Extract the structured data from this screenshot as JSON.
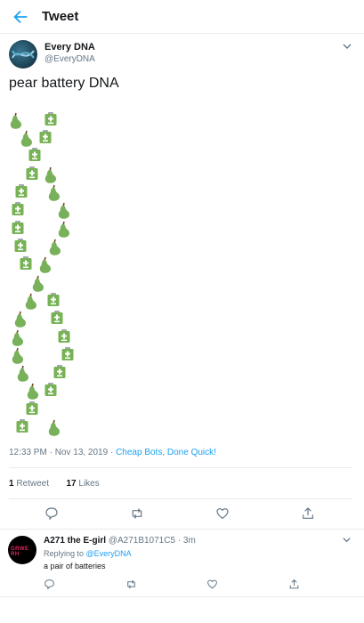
{
  "header": {
    "title": "Tweet"
  },
  "tweet": {
    "author_name": "Every DNA",
    "author_handle": "@EveryDNA",
    "text": "pear battery DNA",
    "art_icons": [
      "pear-emoji",
      "battery-emoji"
    ],
    "timestamp": "12:33 PM · Nov 13, 2019 · ",
    "source": "Cheap Bots, Done Quick!",
    "retweets_count": "1",
    "retweets_label": " Retweet",
    "likes_count": "17",
    "likes_label": " Likes"
  },
  "reply": {
    "author_name": "A271 the E-girl",
    "author_handle": "@A271B1071C5 · 3m",
    "avatar_text": "GRWE RH",
    "replying_to_label": "Replying to ",
    "replying_to_handle": "@EveryDNA",
    "text": "a pair of batteries"
  },
  "colors": {
    "accent": "#1da1f2",
    "text": "#14171a",
    "muted": "#657786",
    "pear": "#78b159",
    "battery": "#77b255",
    "divider": "#e6ecf0"
  }
}
